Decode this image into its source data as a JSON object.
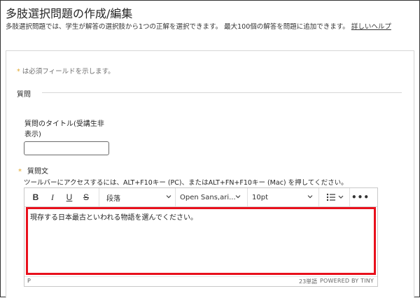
{
  "header": {
    "title": "多肢選択問題の作成/編集",
    "description": "多肢選択問題では、学生が解答の選択肢から1つの正解を選択できます。 最大100個の解答を問題に追加できます。",
    "help_link": "詳しいヘルプ"
  },
  "form": {
    "required_asterisk": "*",
    "required_note": "は必須フィールドを示します。",
    "section_title": "質問",
    "title_label": "質問のタイトル(受講生非表示)",
    "title_value": "",
    "question_label": "質問文",
    "toolbar_hint": "ツールバーにアクセスするには、ALT+F10キー (PC)、またはALT+FN+F10キー (Mac) を押してください。"
  },
  "editor": {
    "toolbar": {
      "bold": "B",
      "italic": "I",
      "underline": "U",
      "strikethrough": "S",
      "paragraph": "段落",
      "font": "Open Sans,ari...",
      "size": "10pt",
      "more": "•••"
    },
    "content": "現存する日本最古といわれる物語を選んでください。",
    "status": {
      "path": "P",
      "word_count": "23単語",
      "powered": "POWERED BY TINY"
    },
    "highlight_color": "#e8101c"
  },
  "colors": {
    "accent_asterisk": "#e2a72b",
    "border": "#d6d6d6"
  },
  "icons": [
    "chevron-down-icon",
    "bullet-list-icon",
    "more-icon"
  ]
}
